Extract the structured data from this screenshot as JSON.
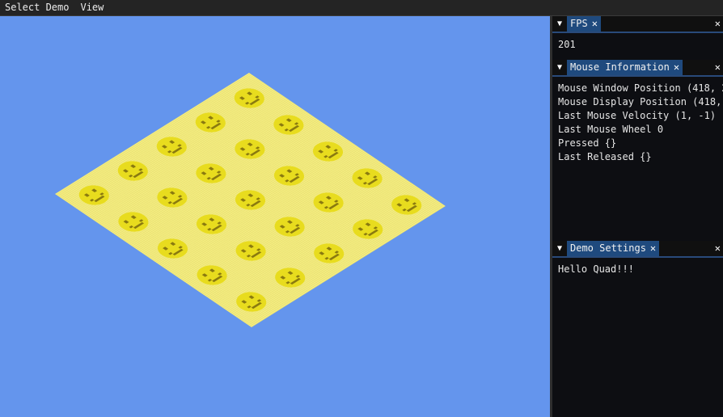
{
  "menu": {
    "items": [
      "Select Demo",
      "View"
    ]
  },
  "fps_panel": {
    "title": "FPS",
    "value": "201"
  },
  "mouse_panel": {
    "title": "Mouse Information",
    "lines": [
      "Mouse Window Position (418, 2",
      "Mouse Display Position (418,",
      "Last Mouse Velocity (1, -1)",
      "Last Mouse Wheel 0",
      "Pressed {}",
      "Last Released {}"
    ]
  },
  "demo_panel": {
    "title": "Demo Settings",
    "text": "Hello Quad!!!"
  },
  "icons": {
    "collapse": "triangle-down-icon",
    "close": "close-icon"
  },
  "colors": {
    "viewport_bg": "#6495ed",
    "quad_fill": "#f5ee83",
    "smiley_face": "#e8dc1e",
    "smiley_feature": "#8a7a10",
    "tab_active": "#1f4a7e",
    "panel_bg": "#0d0e12"
  }
}
